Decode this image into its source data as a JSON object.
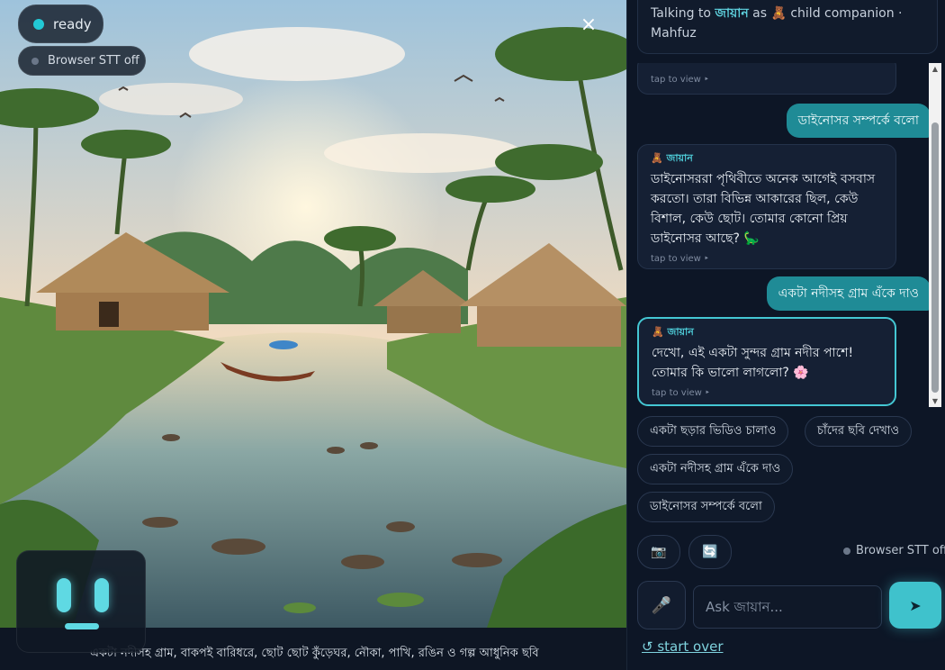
{
  "status": {
    "ready_label": "ready",
    "stt_label": "Browser STT off"
  },
  "scene": {
    "caption": "একটা নদীসহ গ্রাম, বাকপই বারিধরে, ছোট ছোট কুঁড়েঘর, নৌকা, পাখি, রঙিন ও গল্প আধুনিক ছবি",
    "close_icon": "×"
  },
  "panel": {
    "talking": {
      "prefix": "Talking to",
      "name": "জায়ান",
      "as": "as",
      "emoji": "🧸",
      "role": "child companion · Mahfuz"
    },
    "messages": [
      {
        "type": "bot",
        "tap": "tap to view ‣"
      },
      {
        "type": "user",
        "text": "ডাইনোসর সম্পর্কে বলো"
      },
      {
        "type": "bot",
        "name": "🧸 জায়ান",
        "text": "ডাইনোসররা পৃথিবীতে অনেক আগেই বসবাস করতো। তারা বিভিন্ন আকারের ছিল, কেউ বিশাল, কেউ ছোট। তোমার কোনো প্রিয় ডাইনোসর আছে? 🦕",
        "tap": "tap to view ‣"
      },
      {
        "type": "user",
        "text": "একটা নদীসহ গ্রাম এঁকে দাও"
      },
      {
        "type": "bot",
        "name": "🧸 জায়ান",
        "text": "দেখো, এই একটা সুন্দর গ্রাম নদীর পাশে! তোমার কি ভালো লাগলো? 🌸",
        "tap": "tap to view ‣"
      }
    ],
    "chips": [
      "একটা ছড়ার ভিডিও চালাও",
      "চাঁদের ছবি দেখাও",
      "একটা নদীসহ গ্রাম এঁকে দাও",
      "ডাইনোসর সম্পর্কে বলো"
    ],
    "tools": {
      "camera_icon": "📷",
      "switch_icon": "🔄"
    },
    "stt_status": "Browser STT off",
    "input": {
      "placeholder": "Ask জায়ান...",
      "value": ""
    },
    "mic_icon": "🎤",
    "send_icon": "➤",
    "start_over": "↺ start over"
  },
  "colors": {
    "accent": "#3fc2cc",
    "user_bubble": "#1f8b96",
    "panel_bg": "#0d1626"
  }
}
